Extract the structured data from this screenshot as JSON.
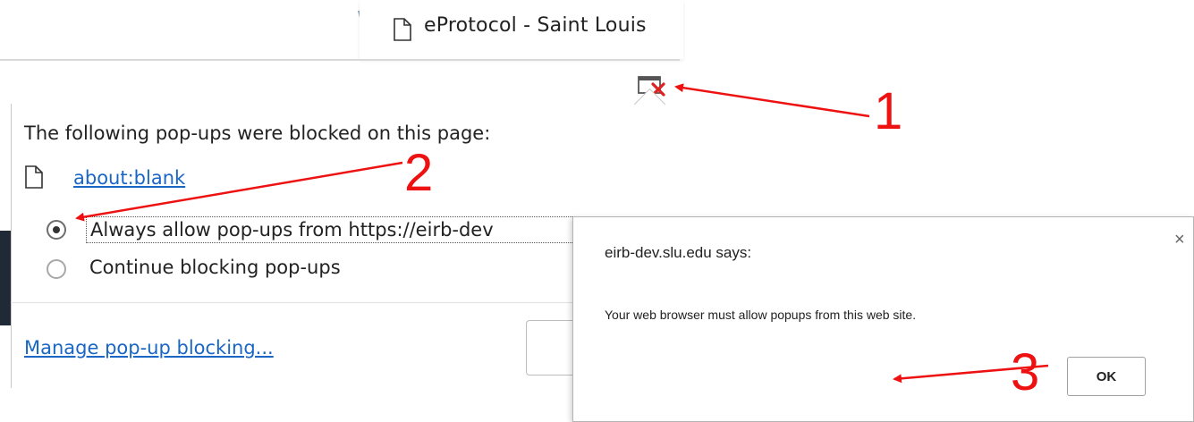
{
  "browser": {
    "tab_title": "eProtocol - Saint Louis"
  },
  "popup_bubble": {
    "heading": "The following pop-ups were blocked on this page:",
    "blocked_link": "about:blank",
    "options": [
      {
        "label": "Always allow pop-ups from https://eirb-dev",
        "selected": true
      },
      {
        "label": "Continue blocking pop-ups",
        "selected": false
      }
    ],
    "manage_link": "Manage pop-up blocking..."
  },
  "alert_dialog": {
    "title": "eirb-dev.slu.edu says:",
    "close_glyph": "×",
    "message": "Your web browser must allow popups from this web site.",
    "ok_label": "OK"
  },
  "annotations": {
    "step_1": "1",
    "step_2": "2",
    "step_3": "3",
    "color": "#ee1111"
  },
  "icons": {
    "tab_page": "document-icon",
    "blocked_popup": "popup-blocked-icon",
    "link_page": "document-icon"
  },
  "colors": {
    "link": "#1a66c4",
    "annotation": "#ee1111",
    "tab_edge": "#8fa3b8"
  }
}
